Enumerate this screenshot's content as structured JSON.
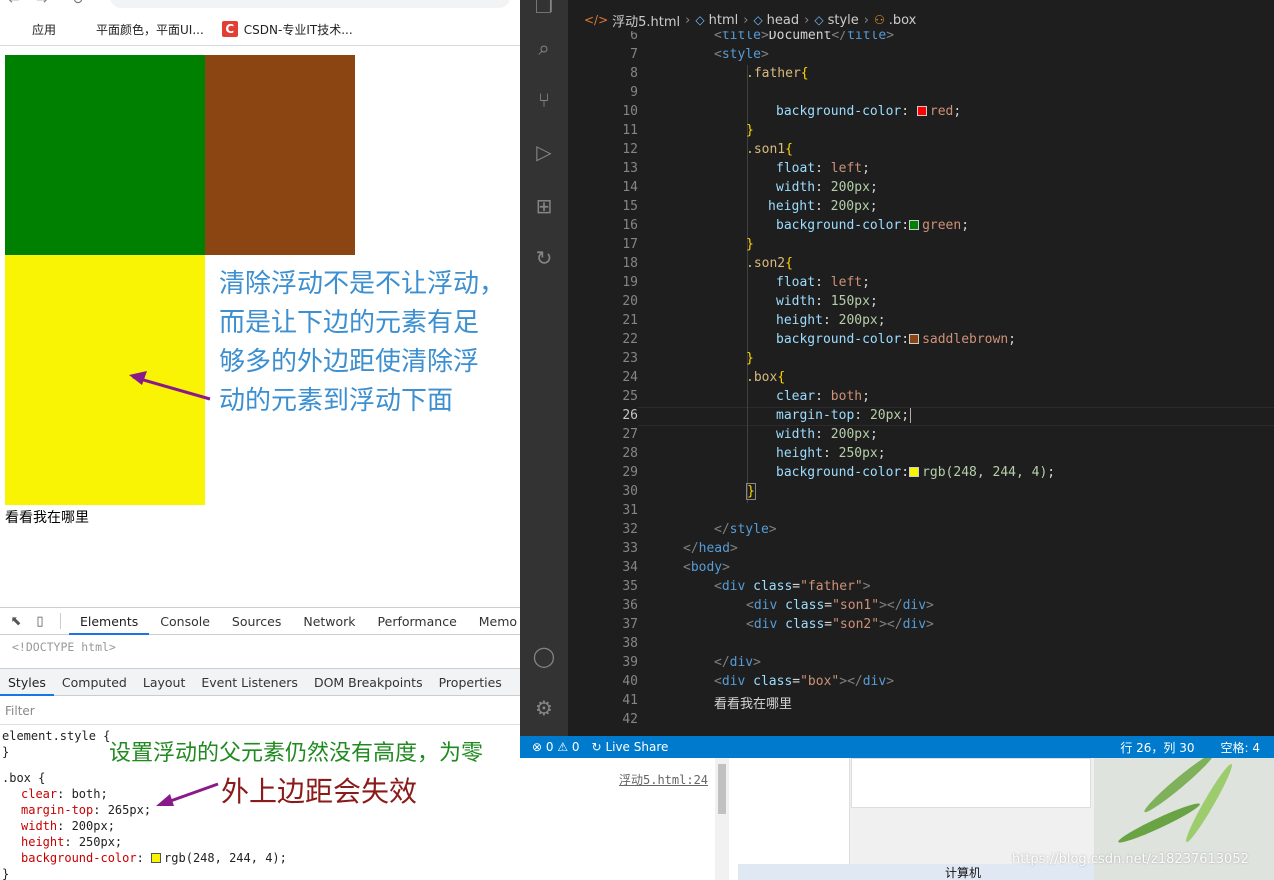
{
  "browser": {
    "bookmarks": [
      {
        "label": "应用",
        "icon": "apps-grid-icon"
      },
      {
        "label": "平面颜色，平面UI...",
        "icon": "color-mosaic-icon"
      },
      {
        "label": "CSDN-专业IT技术...",
        "icon": "csdn-logo-icon"
      }
    ]
  },
  "page": {
    "text": "看看我在哪里",
    "colors": {
      "son1": "#008000",
      "son2": "#8b4513",
      "box": "#f8f404"
    }
  },
  "annotations": {
    "note1": "清除浮动不是不让浮动，\n而是让下边的元素有足\n够多的外边距使清除浮\n动的元素到浮动下面",
    "note2": "设置浮动的父元素仍然没有高度，为零",
    "note3": "外上边距会失效"
  },
  "devtools": {
    "tabs": [
      "Elements",
      "Console",
      "Sources",
      "Network",
      "Performance",
      "Memo"
    ],
    "active_tab": "Elements",
    "dom_line": "<!DOCTYPE html>",
    "sub_tabs": [
      "Styles",
      "Computed",
      "Layout",
      "Event Listeners",
      "DOM Breakpoints",
      "Properties"
    ],
    "active_sub_tab": "Styles",
    "filter_placeholder": "Filter",
    "element_style": "element.style {",
    "element_style_close": "}",
    "rule_selector": ".box {",
    "rule_source": "浮动5.html:24",
    "rule_props": [
      {
        "name": "clear",
        "value": "both;"
      },
      {
        "name": "margin-top",
        "value": "265px;"
      },
      {
        "name": "width",
        "value": "200px;"
      },
      {
        "name": "height",
        "value": "250px;"
      },
      {
        "name": "background-color",
        "value": "rgb(248, 244, 4);",
        "swatch": "#f8f404"
      }
    ],
    "rule_close": "}"
  },
  "vscode": {
    "breadcrumb": [
      "浮动5.html",
      "html",
      "head",
      "style",
      ".box"
    ],
    "line_numbers": [
      "6",
      "7",
      "8",
      "9",
      "10",
      "11",
      "12",
      "13",
      "14",
      "15",
      "16",
      "17",
      "18",
      "19",
      "20",
      "21",
      "22",
      "23",
      "24",
      "25",
      "26",
      "27",
      "28",
      "29",
      "30",
      "31",
      "32",
      "33",
      "34",
      "35",
      "36",
      "37",
      "38",
      "39",
      "40",
      "41",
      "42"
    ],
    "code": {
      "l6_tag": "title",
      "l6_text": "Document",
      "l7_tag": "style",
      "l8_sel": ".father",
      "l10_prop": "background-color",
      "l10_val": "red",
      "l12_sel": ".son1",
      "l13_prop": "float",
      "l13_val": "left",
      "l14_prop": "width",
      "l14_val": "200px",
      "l15_prop": "height",
      "l15_val": "200px",
      "l16_prop": "background-color",
      "l16_val": "green",
      "l18_sel": ".son2",
      "l19_prop": "float",
      "l19_val": "left",
      "l20_prop": "width",
      "l20_val": "150px",
      "l21_prop": "height",
      "l21_val": "200px",
      "l22_prop": "background-color",
      "l22_val": "saddlebrown",
      "l24_sel": ".box",
      "l25_prop": "clear",
      "l25_val": "both",
      "l26_prop": "margin-top",
      "l26_val": "20px",
      "l27_prop": "width",
      "l27_val": "200px",
      "l28_prop": "height",
      "l28_val": "250px",
      "l29_prop": "background-color",
      "l29_val": "rgb(248, 244, 4)",
      "l32_tag": "style",
      "l33_tag": "head",
      "l34_tag": "body",
      "l35_tag": "div",
      "l35_attr": "class",
      "l35_val": "\"father\"",
      "l36_tag": "div",
      "l36_attr": "class",
      "l36_val": "\"son1\"",
      "l37_tag": "div",
      "l37_attr": "class",
      "l37_val": "\"son2\"",
      "l39_tag": "div",
      "l40_tag": "div",
      "l40_attr": "class",
      "l40_val": "\"box\"",
      "l41_text": "看看我在哪里"
    },
    "status": {
      "errors": "0",
      "warnings": "0",
      "live_share": "Live Share",
      "position": "行 26，列 30",
      "spaces": "空格: 4"
    }
  },
  "desktop": {
    "label": "计算机",
    "watermark": "https://blog.csdn.net/z18237613052"
  }
}
